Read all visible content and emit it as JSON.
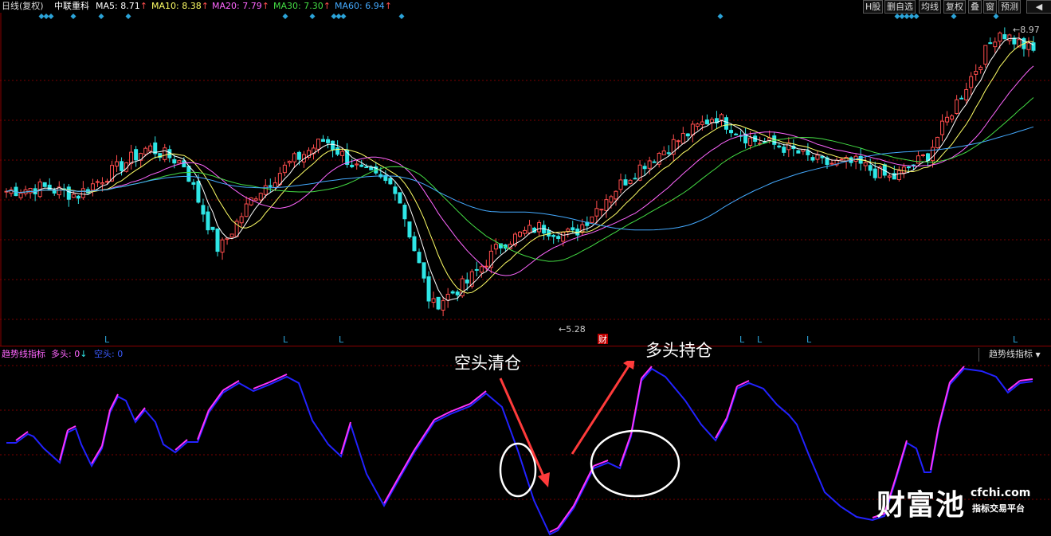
{
  "header": {
    "period": "日线(复权)",
    "stock_name": "中联重科",
    "ma5": "MA5: 8.71",
    "ma10": "MA10: 8.38",
    "ma20": "MA20: 7.79",
    "ma30": "MA30: 7.30",
    "ma60": "MA60: 6.94",
    "up_arrow": "↑"
  },
  "toolbar": [
    "H股",
    "删自选",
    "均线",
    "复权",
    "叠",
    "窗",
    "预测"
  ],
  "toolbar_collapse": "◀",
  "chart": {
    "high_label": "8.97",
    "low_label": "5.28",
    "l_marker": "L",
    "fin_marker": "财"
  },
  "indicator": {
    "name": "趋势线指标",
    "long_label": "多头: 0",
    "long_arrow": "↓",
    "short_label": "空头: 0",
    "selector": "趋势线指标"
  },
  "annotations": {
    "short_clear": "空头清仓",
    "long_hold": "多头持仓"
  },
  "watermark": {
    "brand": "财富池",
    "domain": "cfchi.com",
    "tagline": "指标交易平台"
  },
  "colors": {
    "bg": "#000000",
    "grid": "#7a0000",
    "up": "#ff4d4d",
    "down": "#2ee6e6",
    "ma5": "#ffffff",
    "ma10": "#ffff66",
    "ma20": "#ff66ff",
    "ma30": "#44dd44",
    "ma60": "#44aaff",
    "bull_line": "#ff33ff",
    "bear_line": "#2222ff",
    "marker": "#2ba3d8",
    "arrow_red": "#ff3b3b"
  },
  "chart_data": {
    "type": "line",
    "title": "中联重科",
    "candles_close_anchor": [
      6.95,
      7.0,
      6.9,
      7.2,
      7.5,
      7.3,
      6.2,
      6.9,
      7.3,
      7.6,
      7.2,
      7.0,
      5.5,
      5.8,
      6.3,
      6.5,
      6.4,
      6.9,
      7.3,
      7.6,
      7.9,
      7.6,
      7.5,
      7.3,
      7.3,
      7.1,
      7.4,
      8.2,
      8.97,
      8.7
    ],
    "y_high": 8.97,
    "y_low": 5.28,
    "moving_averages": [
      "MA5",
      "MA10",
      "MA20",
      "MA30",
      "MA60"
    ],
    "indicator_series": [
      "多头",
      "空头"
    ]
  }
}
